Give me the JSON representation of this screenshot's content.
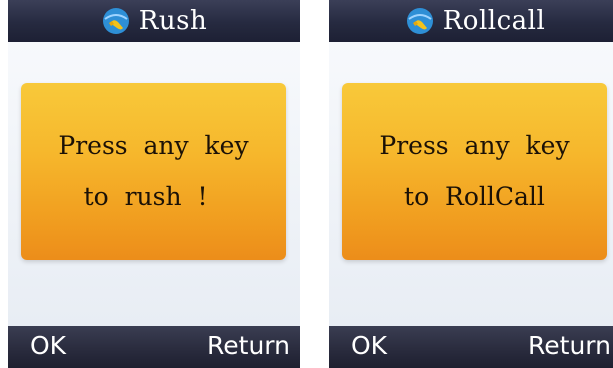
{
  "screens": [
    {
      "title": "Rush",
      "icon": "ptt-handset-icon",
      "message_line1": "Press  any  key",
      "message_line2": "to  rush  !  ",
      "softkey_left": "OK",
      "softkey_right": "Return"
    },
    {
      "title": "Rollcall",
      "icon": "ptt-handset-icon",
      "message_line1": "Press  any  key",
      "message_line2": "to  RollCall",
      "softkey_left": "OK",
      "softkey_right": "Return"
    }
  ],
  "colors": {
    "title_bar": "#262a40",
    "message_box": "#f6b72c",
    "background": "#eef1f6"
  }
}
